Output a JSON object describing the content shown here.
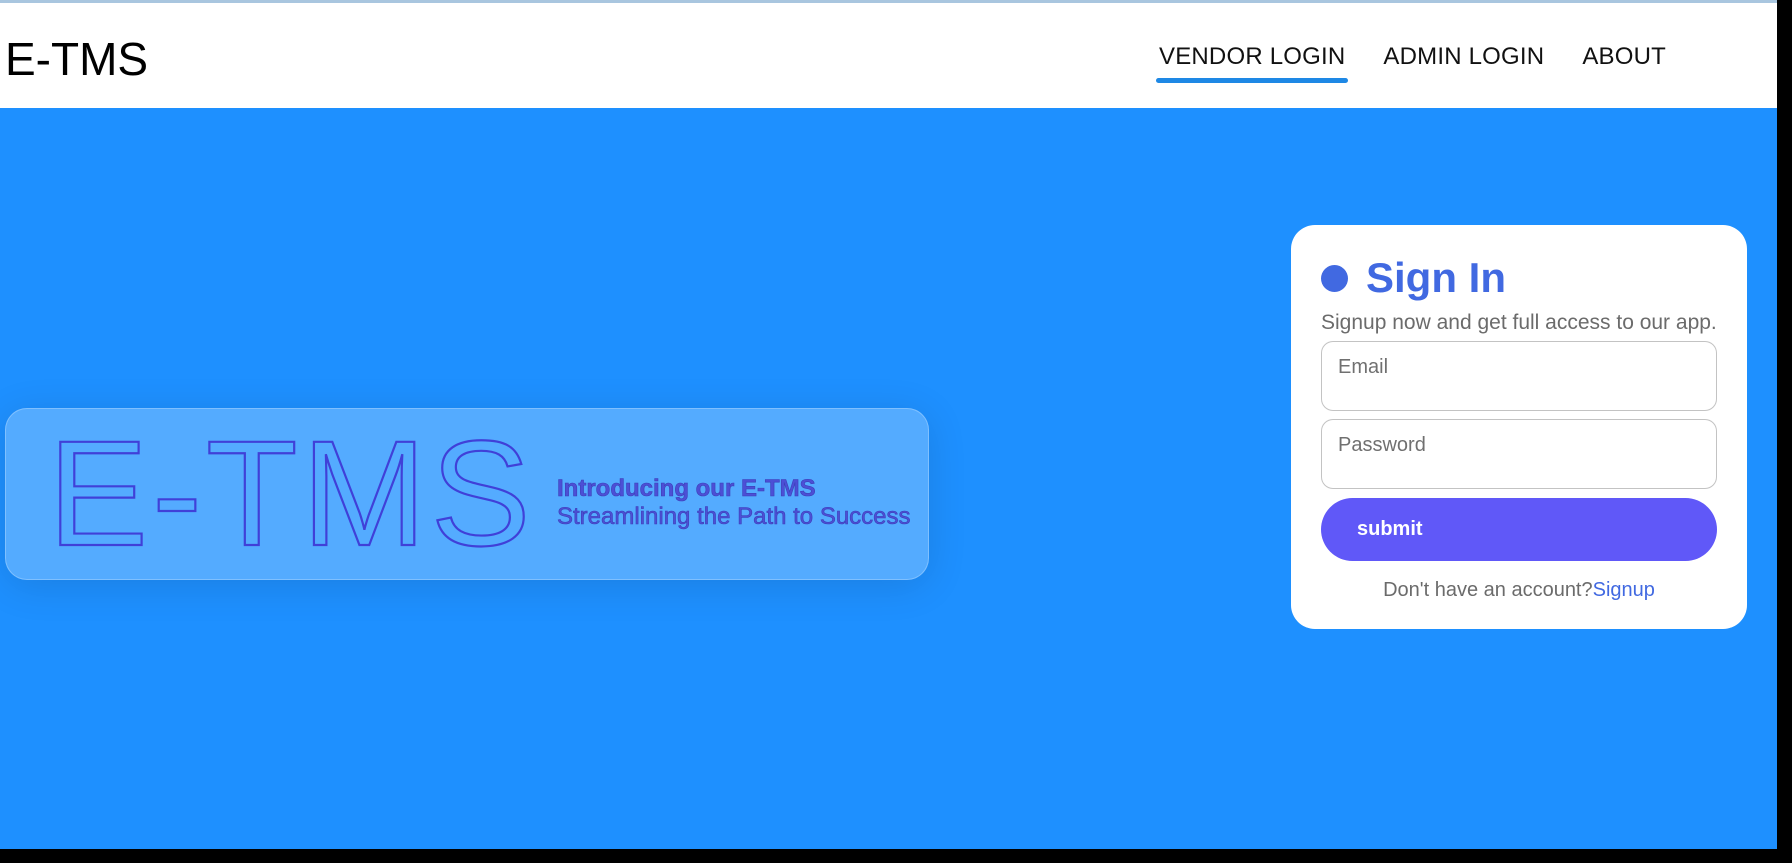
{
  "navbar": {
    "brand": "E-TMS",
    "links": [
      {
        "label": "VENDOR LOGIN",
        "active": true
      },
      {
        "label": "ADMIN LOGIN",
        "active": false
      },
      {
        "label": "ABOUT",
        "active": false
      }
    ]
  },
  "hero": {
    "logo_text": "E-TMS",
    "line1": "Introducing our E-TMS",
    "line2": "Streamlining the Path to Success"
  },
  "signin": {
    "title": "Sign In",
    "subtitle": "Signup now and get full access to our app.",
    "email_placeholder": "Email",
    "password_placeholder": "Password",
    "submit_label": "submit",
    "no_account_text": "Don't have an account?",
    "signup_link": "Signup"
  },
  "colors": {
    "background": "#1e90ff",
    "accent": "#4169e1",
    "button": "#6058f8",
    "hero_text": "#4c4fd6"
  }
}
